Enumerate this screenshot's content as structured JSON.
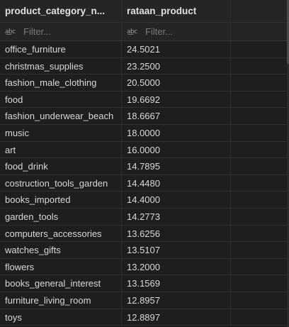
{
  "table": {
    "columns": [
      {
        "label": "product_category_n...",
        "filter_placeholder": "Filter...",
        "type_icon": "abc-type-icon"
      },
      {
        "label": "rataan_product",
        "filter_placeholder": "Filter...",
        "type_icon": "abc-type-icon"
      }
    ],
    "type_icon_text": "a͟bc",
    "rows": [
      [
        "office_furniture",
        "24.5021"
      ],
      [
        "christmas_supplies",
        "23.2500"
      ],
      [
        "fashion_male_clothing",
        "20.5000"
      ],
      [
        "food",
        "19.6692"
      ],
      [
        "fashion_underwear_beach",
        "18.6667"
      ],
      [
        "music",
        "18.0000"
      ],
      [
        "art",
        "16.0000"
      ],
      [
        "food_drink",
        "14.7895"
      ],
      [
        "costruction_tools_garden",
        "14.4480"
      ],
      [
        "books_imported",
        "14.4000"
      ],
      [
        "garden_tools",
        "14.2773"
      ],
      [
        "computers_accessories",
        "13.6256"
      ],
      [
        "watches_gifts",
        "13.5107"
      ],
      [
        "flowers",
        "13.2000"
      ],
      [
        "books_general_interest",
        "13.1569"
      ],
      [
        "furniture_living_room",
        "12.8957"
      ],
      [
        "toys",
        "12.8897"
      ]
    ]
  },
  "colors": {
    "background": "#1e1e1e",
    "header_background": "#252526",
    "grid_line": "#2f2f2f",
    "text": "#d8d8d8",
    "placeholder": "#7a7a7a"
  }
}
